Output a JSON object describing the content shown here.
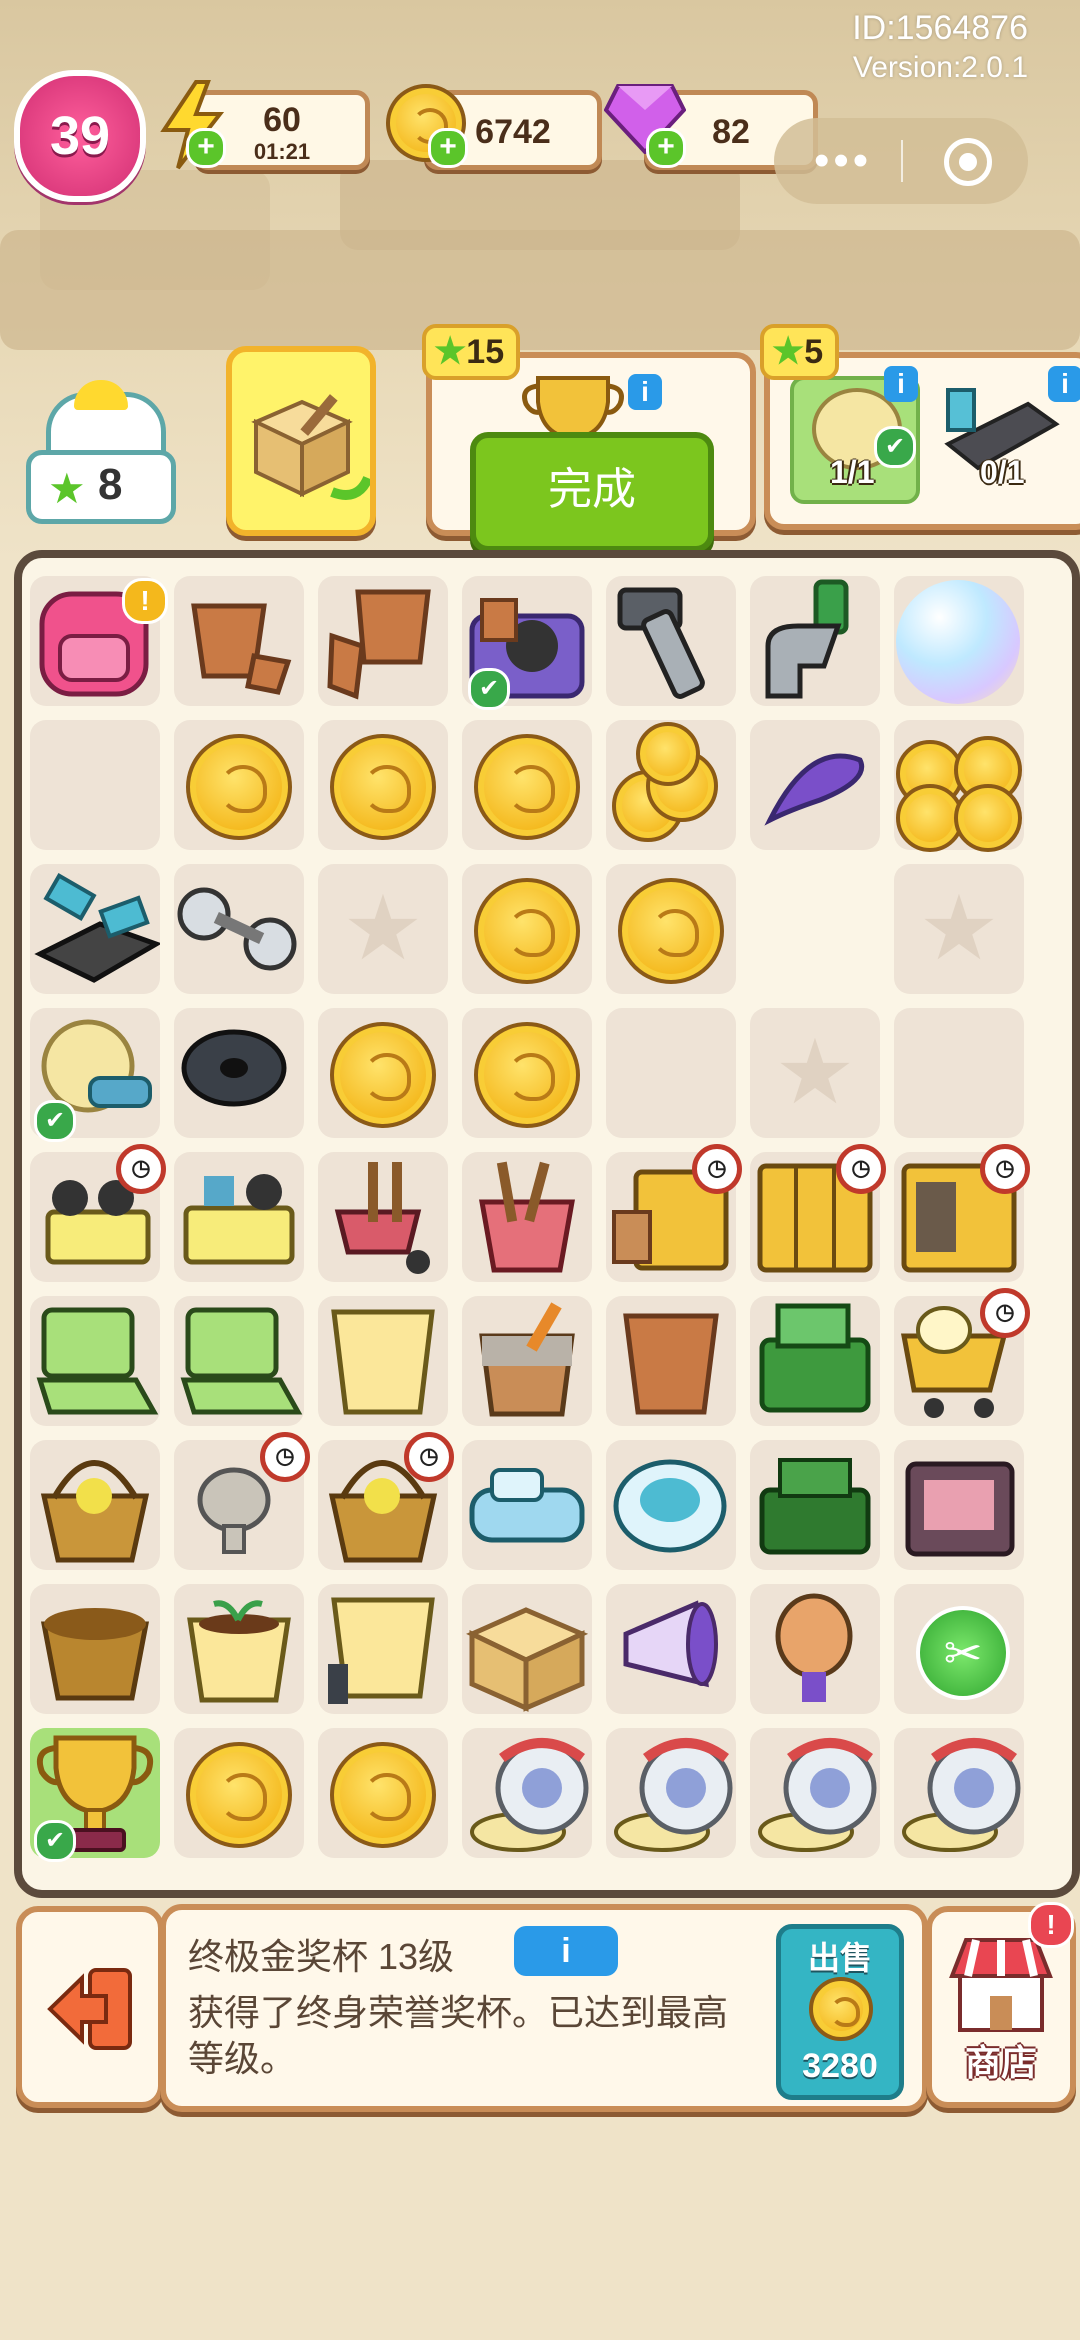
{
  "header": {
    "id_text": "ID:1564876",
    "version_text": "Version:2.0.1",
    "level": "39",
    "energy": {
      "value": "60",
      "timer": "01:21",
      "icon": "lightning-icon"
    },
    "coins": {
      "value": "6742",
      "icon": "coin-icon"
    },
    "gems": {
      "value": "82",
      "icon": "gem-icon"
    }
  },
  "mini_program": {
    "more_icon": "more-dots-icon",
    "close_icon": "target-icon"
  },
  "house": {
    "stars": "8"
  },
  "tasks": [
    {
      "reward": "15",
      "button": "完成"
    },
    {
      "reward": "5",
      "slots": [
        {
          "progress": "1/1",
          "done": true
        },
        {
          "progress": "0/1",
          "done": false
        }
      ]
    }
  ],
  "selected_item": {
    "title": "终极金奖杯 13级",
    "info_label": "i",
    "description": "获得了终身荣誉奖杯。已达到最高等级。",
    "sell_label": "出售",
    "sell_price": "3280"
  },
  "shop": {
    "label": "商店",
    "alert": "!"
  },
  "colors": {
    "accent_green": "#7cc61e",
    "border_brown": "#c98d57",
    "coin_gold": "#f4b81c",
    "level_pink": "#e9407f"
  }
}
